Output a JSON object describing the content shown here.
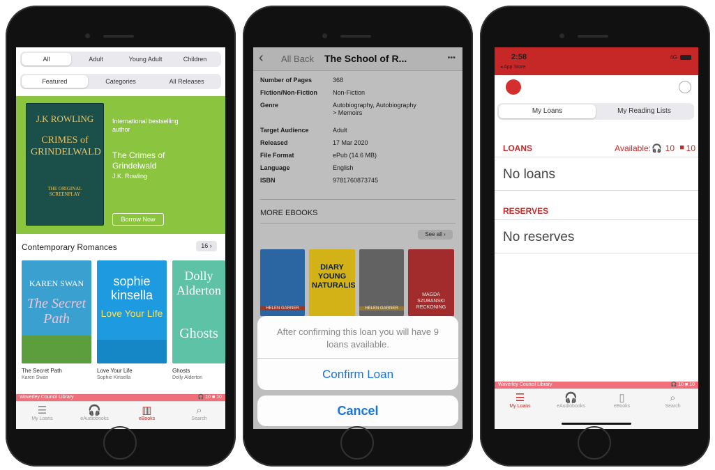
{
  "phone1": {
    "seg1": [
      "All",
      "Adult",
      "Young Adult",
      "Children"
    ],
    "seg2": [
      "Featured",
      "Categories",
      "All Releases"
    ],
    "feature": {
      "cover_author": "J.K ROWLING",
      "cover_title": "CRIMES of GRINDELWALD",
      "cover_sub": "THE ORIGINAL SCREENPLAY",
      "tagline": "International bestselling author",
      "title": "The Crimes of Grindelwald",
      "author": "J.K. Rowling",
      "button": "Borrow Now"
    },
    "section_title": "Contemporary Romances",
    "section_count": "16 ›",
    "books": [
      {
        "cover_a": "KAREN SWAN",
        "cover_b": "The Secret Path",
        "title": "The Secret Path",
        "author": "Karen Swan",
        "color": "#3aa0d0"
      },
      {
        "cover_a": "sophie kinsella",
        "cover_b": "Love Your Life",
        "title": "Love Your Life",
        "author": "Sophie Kinsella",
        "color": "#1e9be0"
      },
      {
        "cover_a": "Dolly Alderton",
        "cover_b": "Ghosts",
        "title": "Ghosts",
        "author": "Dolly Alderton",
        "color": "#5ec2a6"
      }
    ],
    "library": "Waverley Council Library",
    "counts": "🎧 10  ■ 10",
    "tabs": [
      {
        "icon": "☰",
        "label": "My Loans",
        "active": false
      },
      {
        "icon": "🎧",
        "label": "eAudiobooks",
        "active": false
      },
      {
        "icon": "▥",
        "label": "eBooks",
        "active": true
      },
      {
        "icon": "⌕",
        "label": "Search",
        "active": false
      }
    ]
  },
  "phone2": {
    "back_chev": "‹",
    "back": "All Back",
    "title": "The School of R...",
    "more": "•••",
    "meta": [
      {
        "k": "Number of Pages",
        "v": "368"
      },
      {
        "k": "Fiction/Non-Fiction",
        "v": "Non-Fiction"
      },
      {
        "k": "Genre",
        "v": "Autobiography, Autobiography > Memoirs"
      },
      {
        "k": "Target Audience",
        "v": "Adult"
      },
      {
        "k": "Released",
        "v": "17 Mar 2020"
      },
      {
        "k": "File Format",
        "v": "ePub (14.6 MB)"
      },
      {
        "k": "Language",
        "v": "English"
      },
      {
        "k": "ISBN",
        "v": "9781760873745"
      }
    ],
    "more_title": "MORE EBOOKS",
    "see_all": "See all ›",
    "books": [
      {
        "label": "HELEN GARNER",
        "color": "#2f6fb0"
      },
      {
        "label": "DIARY YOUNG NATURALIST",
        "color": "#e5c21b"
      },
      {
        "label": "HELEN GARNER",
        "color": "#6b6b6b"
      },
      {
        "label": "MAGDA SZUBANSKI RECKONING",
        "color": "#b03030"
      }
    ],
    "sheet_message": "After confirming this loan you will have 9 loans available.",
    "confirm": "Confirm Loan",
    "cancel": "Cancel"
  },
  "phone3": {
    "time": "2:58",
    "carrier": "◂ App Store",
    "signal": "4G",
    "seg": [
      "My Loans",
      "My Reading Lists"
    ],
    "loans_label": "LOANS",
    "available_label": "Available:",
    "available_audio": "10",
    "available_books": "10",
    "no_loans": "No loans",
    "reserves_label": "RESERVES",
    "no_reserves": "No reserves",
    "library": "Waverley Council Library",
    "counts": "🎧 10  ■ 10",
    "tabs": [
      {
        "icon": "☰",
        "label": "My Loans",
        "active": true
      },
      {
        "icon": "🎧",
        "label": "eAudiobooks",
        "active": false
      },
      {
        "icon": "▯",
        "label": "eBooks",
        "active": false
      },
      {
        "icon": "⌕",
        "label": "Search",
        "active": false
      }
    ],
    "brand_color": "#c62828"
  }
}
